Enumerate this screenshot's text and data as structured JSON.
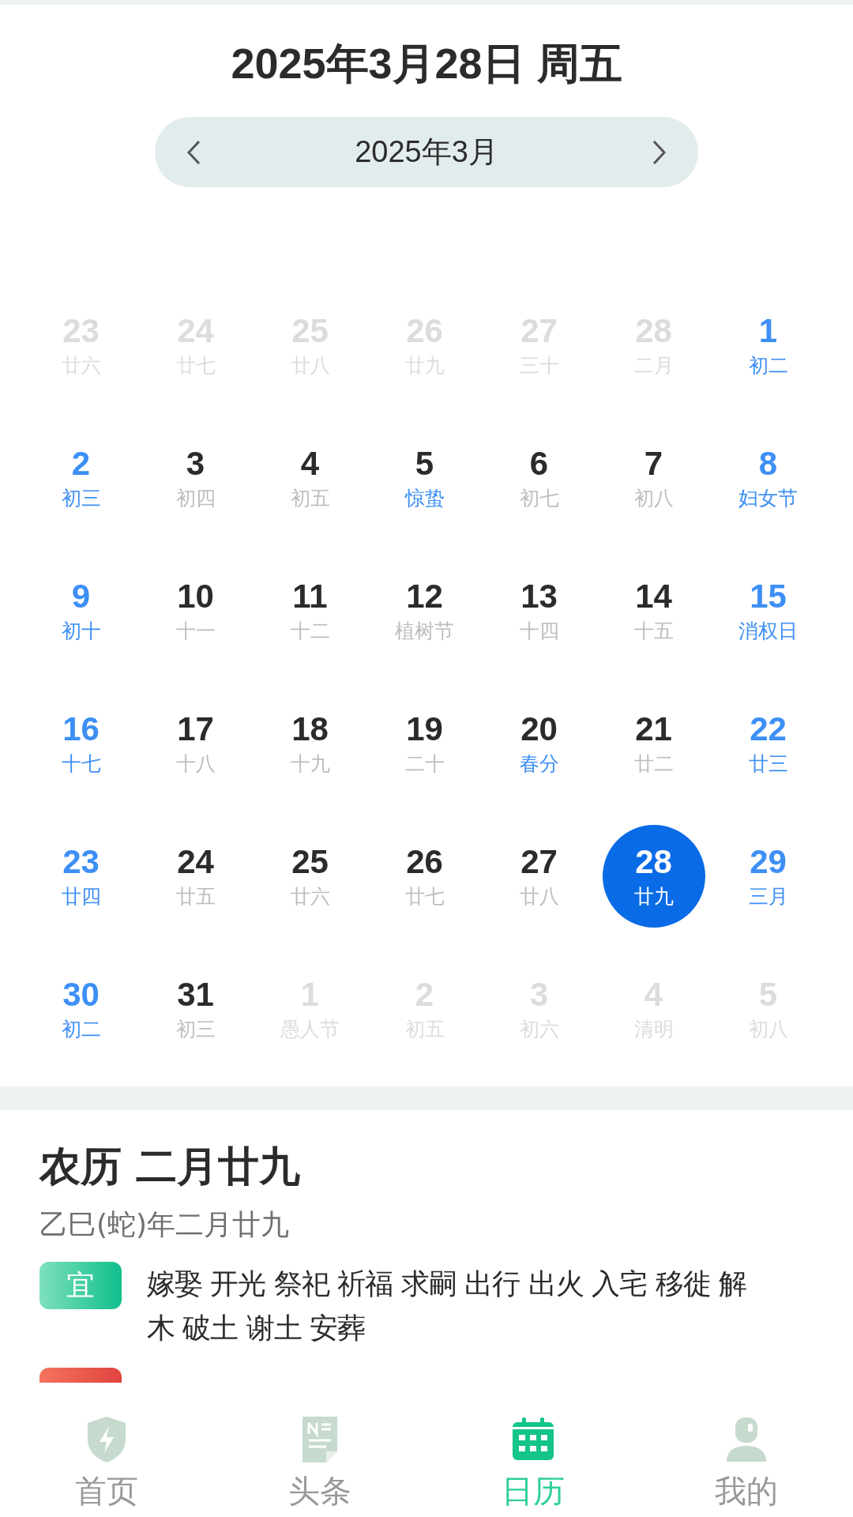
{
  "header": {
    "date_title": "2025年3月28日 周五",
    "month_label": "2025年3月"
  },
  "calendar": {
    "weeks": [
      [
        {
          "day": "23",
          "sub": "廿六",
          "kind": "other",
          "selected": false
        },
        {
          "day": "24",
          "sub": "廿七",
          "kind": "other",
          "selected": false
        },
        {
          "day": "25",
          "sub": "廿八",
          "kind": "other",
          "selected": false
        },
        {
          "day": "26",
          "sub": "廿九",
          "kind": "other",
          "selected": false
        },
        {
          "day": "27",
          "sub": "三十",
          "kind": "other",
          "selected": false
        },
        {
          "day": "28",
          "sub": "二月",
          "kind": "other",
          "selected": false
        },
        {
          "day": "1",
          "sub": "初二",
          "kind": "weekend",
          "selected": false
        }
      ],
      [
        {
          "day": "2",
          "sub": "初三",
          "kind": "weekend",
          "selected": false
        },
        {
          "day": "3",
          "sub": "初四",
          "kind": "weekday",
          "festival": false,
          "selected": false
        },
        {
          "day": "4",
          "sub": "初五",
          "kind": "weekday",
          "festival": false,
          "selected": false
        },
        {
          "day": "5",
          "sub": "惊蛰",
          "kind": "weekday",
          "festival": true,
          "selected": false
        },
        {
          "day": "6",
          "sub": "初七",
          "kind": "weekday",
          "festival": false,
          "selected": false
        },
        {
          "day": "7",
          "sub": "初八",
          "kind": "weekday",
          "festival": false,
          "selected": false
        },
        {
          "day": "8",
          "sub": "妇女节",
          "kind": "weekend",
          "selected": false
        }
      ],
      [
        {
          "day": "9",
          "sub": "初十",
          "kind": "weekend",
          "selected": false
        },
        {
          "day": "10",
          "sub": "十一",
          "kind": "weekday",
          "festival": false,
          "selected": false
        },
        {
          "day": "11",
          "sub": "十二",
          "kind": "weekday",
          "festival": false,
          "selected": false
        },
        {
          "day": "12",
          "sub": "植树节",
          "kind": "weekday",
          "festival": false,
          "selected": false
        },
        {
          "day": "13",
          "sub": "十四",
          "kind": "weekday",
          "festival": false,
          "selected": false
        },
        {
          "day": "14",
          "sub": "十五",
          "kind": "weekday",
          "festival": false,
          "selected": false
        },
        {
          "day": "15",
          "sub": "消权日",
          "kind": "weekend",
          "selected": false
        }
      ],
      [
        {
          "day": "16",
          "sub": "十七",
          "kind": "weekend",
          "selected": false
        },
        {
          "day": "17",
          "sub": "十八",
          "kind": "weekday",
          "festival": false,
          "selected": false
        },
        {
          "day": "18",
          "sub": "十九",
          "kind": "weekday",
          "festival": false,
          "selected": false
        },
        {
          "day": "19",
          "sub": "二十",
          "kind": "weekday",
          "festival": false,
          "selected": false
        },
        {
          "day": "20",
          "sub": "春分",
          "kind": "weekday",
          "festival": true,
          "selected": false
        },
        {
          "day": "21",
          "sub": "廿二",
          "kind": "weekday",
          "festival": false,
          "selected": false
        },
        {
          "day": "22",
          "sub": "廿三",
          "kind": "weekend",
          "selected": false
        }
      ],
      [
        {
          "day": "23",
          "sub": "廿四",
          "kind": "weekend",
          "selected": false
        },
        {
          "day": "24",
          "sub": "廿五",
          "kind": "weekday",
          "festival": false,
          "selected": false
        },
        {
          "day": "25",
          "sub": "廿六",
          "kind": "weekday",
          "festival": false,
          "selected": false
        },
        {
          "day": "26",
          "sub": "廿七",
          "kind": "weekday",
          "festival": false,
          "selected": false
        },
        {
          "day": "27",
          "sub": "廿八",
          "kind": "weekday",
          "festival": false,
          "selected": false
        },
        {
          "day": "28",
          "sub": "廿九",
          "kind": "weekday",
          "festival": false,
          "selected": true
        },
        {
          "day": "29",
          "sub": "三月",
          "kind": "weekend",
          "selected": false
        }
      ],
      [
        {
          "day": "30",
          "sub": "初二",
          "kind": "weekend",
          "selected": false
        },
        {
          "day": "31",
          "sub": "初三",
          "kind": "weekday",
          "festival": false,
          "selected": false
        },
        {
          "day": "1",
          "sub": "愚人节",
          "kind": "other",
          "selected": false
        },
        {
          "day": "2",
          "sub": "初五",
          "kind": "other",
          "selected": false
        },
        {
          "day": "3",
          "sub": "初六",
          "kind": "other",
          "selected": false
        },
        {
          "day": "4",
          "sub": "清明",
          "kind": "other",
          "selected": false
        },
        {
          "day": "5",
          "sub": "初八",
          "kind": "other",
          "selected": false
        }
      ]
    ]
  },
  "almanac": {
    "lunar_title": "农历 二月廿九",
    "ganzhi": "乙巳(蛇)年二月廿九",
    "entries": [
      {
        "kind": "good",
        "badge": "宜",
        "lines": [
          "嫁娶 开光 祭祀 祈福 求嗣 出行 出火 入宅 移徙 解",
          "木 破土 谢土 安葬"
        ]
      },
      {
        "kind": "bad"
      }
    ]
  },
  "nav": [
    {
      "label": "首页",
      "kind": "shield",
      "selected": false
    },
    {
      "label": "头条",
      "kind": "news",
      "selected": false
    },
    {
      "label": "日历",
      "kind": "calendar",
      "selected": true
    },
    {
      "label": "我的",
      "kind": "person",
      "selected": false
    }
  ]
}
